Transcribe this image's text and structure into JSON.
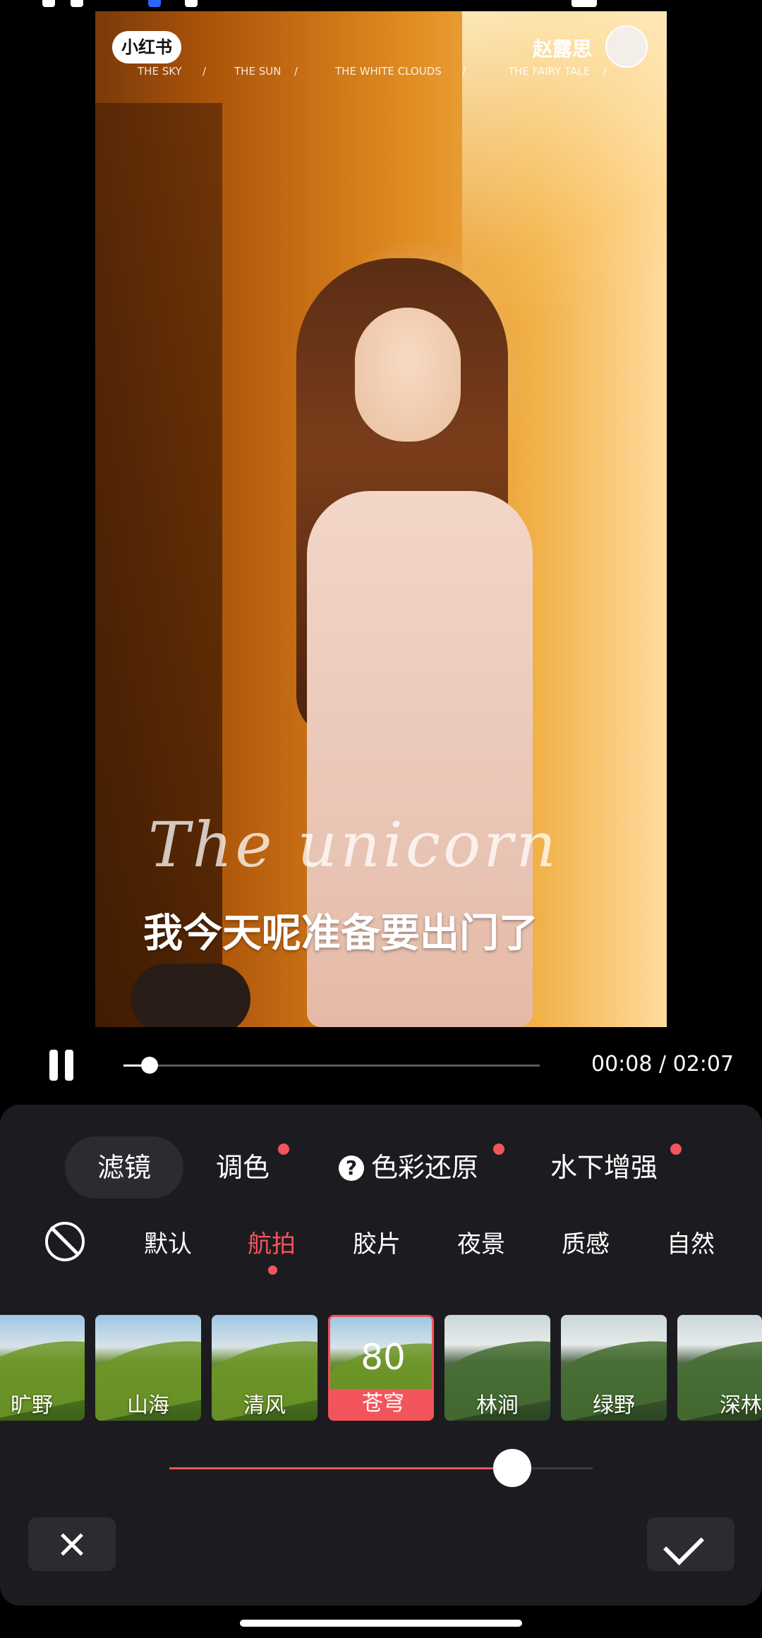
{
  "watermark": {
    "logo": "小红书",
    "author": "赵露思",
    "nav": [
      "THE SKY",
      "/",
      "THE SUN",
      "/",
      "THE WHITE CLOUDS",
      "/",
      "THE FAIRY TALE",
      "/"
    ],
    "script_text": "The unicorn",
    "subtitle": "我今天呢准备要出门了"
  },
  "player": {
    "time": "00:08 / 02:07",
    "progress": 0.063
  },
  "tabs": [
    {
      "label": "滤镜",
      "active": true,
      "dot": false
    },
    {
      "label": "调色",
      "active": false,
      "dot": true
    },
    {
      "label": "色彩还原",
      "active": false,
      "dot": true
    },
    {
      "label": "水下增强",
      "active": false,
      "dot": true
    }
  ],
  "categories": [
    "默认",
    "航拍",
    "胶片",
    "夜景",
    "质感",
    "自然"
  ],
  "selected_category": "航拍",
  "filters": [
    {
      "label": "旷野"
    },
    {
      "label": "山海"
    },
    {
      "label": "清风"
    },
    {
      "label": "苍穹",
      "selected": true,
      "value": "80"
    },
    {
      "label": "林涧"
    },
    {
      "label": "绿野"
    },
    {
      "label": "深林"
    }
  ],
  "intensity": 0.81,
  "colors": {
    "accent": "#f2545b",
    "panel": "#1c1c20"
  }
}
